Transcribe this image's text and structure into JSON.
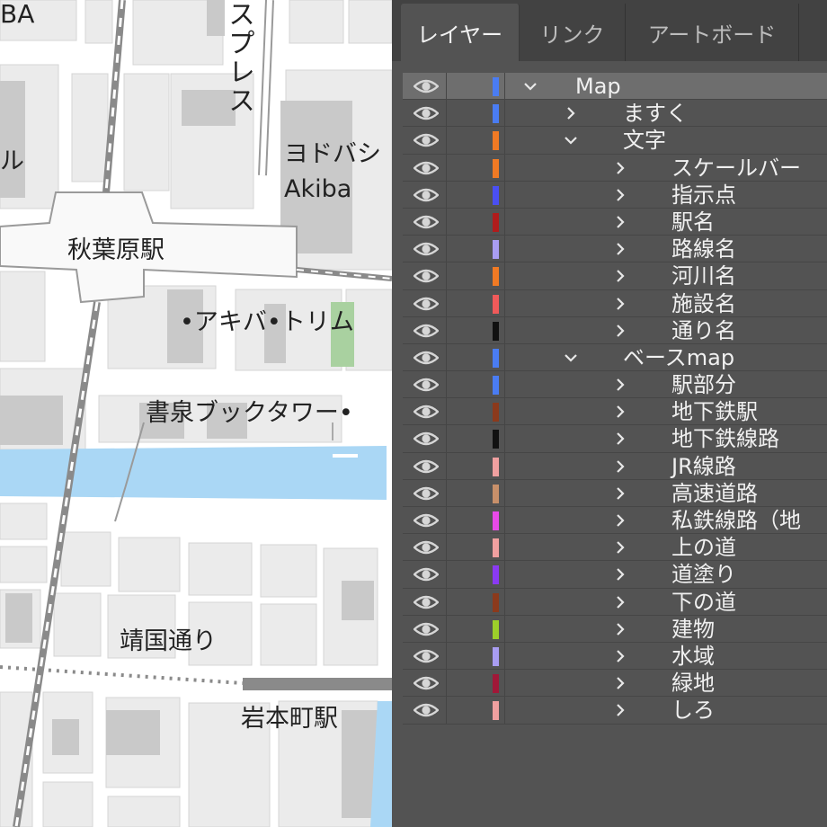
{
  "map": {
    "labels": {
      "top_left_ba": "BA",
      "left_ru": "ル",
      "express_vertical": "スプレス",
      "yodobashi_line1": "ヨドバシ",
      "yodobashi_line2": "Akiba",
      "akihabara_station": "秋葉原駅",
      "akiba_trim": "•アキバ•トリム",
      "shosen_book_tower": "書泉ブックタワー•",
      "yasukuni_street": "靖国通り",
      "iwamotocho_station": "岩本町駅"
    },
    "colors": {
      "road": "#ffffff",
      "block": "#eaeaea",
      "building": "#c9c9c9",
      "water": "#aad7f5",
      "park": "#a9d1a0",
      "rail": "#8a8a8a"
    }
  },
  "panel": {
    "tabs": [
      {
        "label": "レイヤー",
        "active": true
      },
      {
        "label": "リンク",
        "active": false
      },
      {
        "label": "アートボード",
        "active": false
      }
    ],
    "layers": [
      {
        "name": "Map",
        "level": 0,
        "expanded": true,
        "color": "#4a7cf2",
        "selected": true
      },
      {
        "name": "ますく",
        "level": 1,
        "expanded": false,
        "color": "#4a7cf2"
      },
      {
        "name": "文字",
        "level": 1,
        "expanded": true,
        "color": "#f07a24"
      },
      {
        "name": "スケールバー",
        "level": 2,
        "expanded": false,
        "color": "#f07a24"
      },
      {
        "name": "指示点",
        "level": 2,
        "expanded": false,
        "color": "#4a4ff2"
      },
      {
        "name": "駅名",
        "level": 2,
        "expanded": false,
        "color": "#b01c1c"
      },
      {
        "name": "路線名",
        "level": 2,
        "expanded": false,
        "color": "#a99df2"
      },
      {
        "name": "河川名",
        "level": 2,
        "expanded": false,
        "color": "#f07a24"
      },
      {
        "name": "施設名",
        "level": 2,
        "expanded": false,
        "color": "#f05a5a"
      },
      {
        "name": "通り名",
        "level": 2,
        "expanded": false,
        "color": "#111111"
      },
      {
        "name": "ベースmap",
        "level": 1,
        "expanded": true,
        "color": "#4a7cf2"
      },
      {
        "name": "駅部分",
        "level": 2,
        "expanded": false,
        "color": "#4a7cf2"
      },
      {
        "name": "地下鉄駅",
        "level": 2,
        "expanded": false,
        "color": "#8b3a1c"
      },
      {
        "name": "地下鉄線路",
        "level": 2,
        "expanded": false,
        "color": "#111111"
      },
      {
        "name": "JR線路",
        "level": 2,
        "expanded": false,
        "color": "#f0a0a0"
      },
      {
        "name": "高速道路",
        "level": 2,
        "expanded": false,
        "color": "#c8906a"
      },
      {
        "name": "私鉄線路（地",
        "level": 2,
        "expanded": false,
        "color": "#e84ae8"
      },
      {
        "name": "上の道",
        "level": 2,
        "expanded": false,
        "color": "#f0a0a0"
      },
      {
        "name": "道塗り",
        "level": 2,
        "expanded": false,
        "color": "#8a3af2"
      },
      {
        "name": "下の道",
        "level": 2,
        "expanded": false,
        "color": "#8b3a1c"
      },
      {
        "name": "建物",
        "level": 2,
        "expanded": false,
        "color": "#9ccf2a"
      },
      {
        "name": "水域",
        "level": 2,
        "expanded": false,
        "color": "#a99df2"
      },
      {
        "name": "緑地",
        "level": 2,
        "expanded": false,
        "color": "#a01838"
      },
      {
        "name": "しろ",
        "level": 2,
        "expanded": false,
        "color": "#f0a0a0"
      }
    ]
  }
}
